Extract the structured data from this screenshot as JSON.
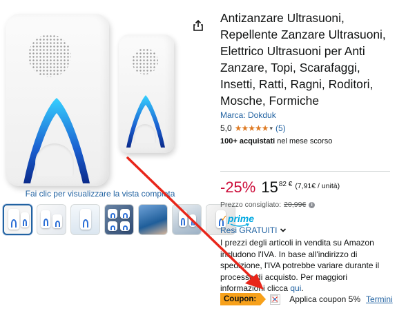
{
  "product": {
    "title": "Antizanzare Ultrasuoni, Repellente Zanzare Ultrasuoni, Elettrico Ultrasuoni per Anti Zanzare, Topi, Scarafaggi, Insetti, Ratti, Ragni, Roditori, Mosche, Formiche",
    "brand_link": "Marca: Dokduk",
    "rating_value": "5,0",
    "stars": "★★★★★",
    "rating_chevron": "▾",
    "review_count": "(5)",
    "sold_bold": "100+ acquistati",
    "sold_rest": " nel mese scorso"
  },
  "gallery": {
    "view_hint": "Fai clic per visualizzare la vista completa",
    "thumbnail_count": 7,
    "accent_color": "#1f6fd6"
  },
  "price": {
    "discount": "-25%",
    "whole": "15",
    "fraction_currency": "82 €",
    "unit_price": "(7,91€ / unità)",
    "list_label": "Prezzo consigliato:",
    "list_value": "20,99€",
    "info_glyph": "i"
  },
  "prime": {
    "check": "✓",
    "word": "prime",
    "color": "#00a8e1"
  },
  "returns": {
    "label": "Resi GRATUITI"
  },
  "vat": {
    "text": "I prezzi degli articoli in vendita su Amazon includono l'IVA. In base all'indirizzo di spedizione, l'IVA potrebbe variare durante il processo di acquisto. Per maggiori informazioni clicca ",
    "link": "qui",
    "end": "."
  },
  "coupon": {
    "tag": "Coupon:",
    "label": "Applica coupon 5%",
    "terms": "Termini",
    "tag_color": "#f7a11b"
  },
  "annotation": {
    "arrow_color": "#e8261a"
  }
}
